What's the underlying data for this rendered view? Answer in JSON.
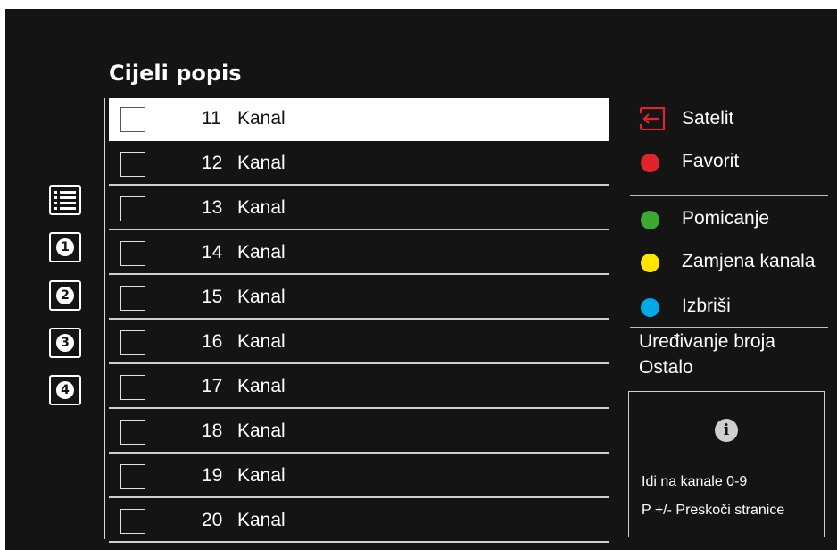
{
  "title": "Cijeli popis",
  "side_icons": [
    {
      "name": "list-icon",
      "label": ""
    },
    {
      "name": "filter-1-icon",
      "label": "1"
    },
    {
      "name": "filter-2-icon",
      "label": "2"
    },
    {
      "name": "filter-3-icon",
      "label": "3"
    },
    {
      "name": "filter-4-icon",
      "label": "4"
    }
  ],
  "channels": [
    {
      "number": "11",
      "name": "Kanal",
      "selected": true
    },
    {
      "number": "12",
      "name": "Kanal"
    },
    {
      "number": "13",
      "name": "Kanal"
    },
    {
      "number": "14",
      "name": "Kanal"
    },
    {
      "number": "15",
      "name": "Kanal"
    },
    {
      "number": "16",
      "name": "Kanal"
    },
    {
      "number": "17",
      "name": "Kanal"
    },
    {
      "number": "18",
      "name": "Kanal"
    },
    {
      "number": "19",
      "name": "Kanal"
    },
    {
      "number": "20",
      "name": "Kanal"
    }
  ],
  "legend": {
    "source": {
      "label": "Satelit",
      "icon": "source-input-icon",
      "color": "#e0242b"
    },
    "red": {
      "label": "Favorit",
      "color": "#e0242b"
    },
    "green": {
      "label": "Pomicanje",
      "color": "#3aaa35"
    },
    "yellow": {
      "label": "Zamjena kanala",
      "color": "#ffe500"
    },
    "blue": {
      "label": "Izbriši",
      "color": "#00a9e8"
    }
  },
  "other": {
    "line1": "Uređivanje broja",
    "line2": "Ostalo"
  },
  "info": {
    "icon": "info-icon",
    "icon_glyph": "i",
    "line1": "Idi na kanale 0-9",
    "line2": "P +/- Preskoči stranice"
  }
}
